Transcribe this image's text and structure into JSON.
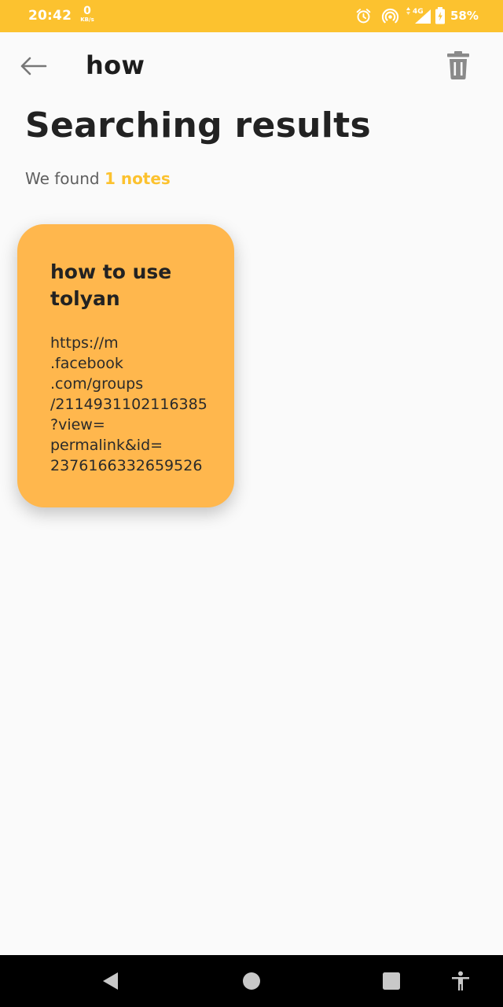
{
  "status_bar": {
    "time": "20:42",
    "net_speed_value": "0",
    "net_speed_unit": "KB/s",
    "network_type": "4G",
    "battery": "58%",
    "color": "#fcc22f",
    "icons": [
      "alarm-icon",
      "hotspot-icon",
      "signal-icon",
      "battery-icon"
    ]
  },
  "header": {
    "search_query": "how",
    "back_icon": "arrow-left-icon",
    "delete_icon": "trash-icon"
  },
  "main": {
    "title": "Searching results",
    "found_prefix": "We found ",
    "found_count": "1 notes",
    "accent_color": "#fcc22f"
  },
  "notes": [
    {
      "title": "how to use tolyan",
      "content": "https://m\n.facebook\n.com/groups\n/2114931102116385\n?view=\npermalink&id=\n2376166332659526",
      "color": "#ffb74d"
    }
  ],
  "nav_bar": {
    "icons": [
      "back-triangle-icon",
      "home-circle-icon",
      "recents-square-icon",
      "accessibility-icon"
    ]
  }
}
